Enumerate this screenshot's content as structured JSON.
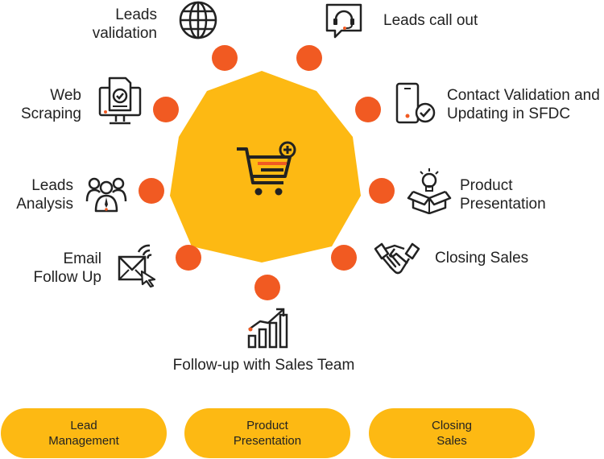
{
  "colors": {
    "hub_fill": "#fdb913",
    "dot_fill": "#f15a22",
    "pill_fill": "#fdb913",
    "icon_stroke": "#222222",
    "icon_accent": "#f15a22"
  },
  "hub": {
    "icon": "shopping-cart-plus-icon"
  },
  "nodes": [
    {
      "id": "leads-validation",
      "label": "Leads\nvalidation",
      "icon": "globe-icon"
    },
    {
      "id": "leads-call-out",
      "label": "Leads call out",
      "icon": "headset-chat-icon"
    },
    {
      "id": "web-scraping",
      "label": "Web\nScraping",
      "icon": "monitor-document-check-icon"
    },
    {
      "id": "contact-validation",
      "label": "Contact Validation and\nUpdating in SFDC",
      "icon": "mobile-check-icon"
    },
    {
      "id": "leads-analysis",
      "label": "Leads\nAnalysis",
      "icon": "group-users-icon"
    },
    {
      "id": "product-presentation",
      "label": "Product\nPresentation",
      "icon": "box-lightbulb-icon"
    },
    {
      "id": "email-follow-up",
      "label": "Email\nFollow Up",
      "icon": "email-cursor-icon"
    },
    {
      "id": "closing-sales",
      "label": "Closing Sales",
      "icon": "handshake-icon"
    },
    {
      "id": "follow-up-sales-team",
      "label": "Follow-up with Sales Team",
      "icon": "growth-bar-chart-icon"
    }
  ],
  "pills": [
    {
      "label": "Lead\nManagement"
    },
    {
      "label": "Product\nPresentation"
    },
    {
      "label": "Closing\nSales"
    }
  ]
}
